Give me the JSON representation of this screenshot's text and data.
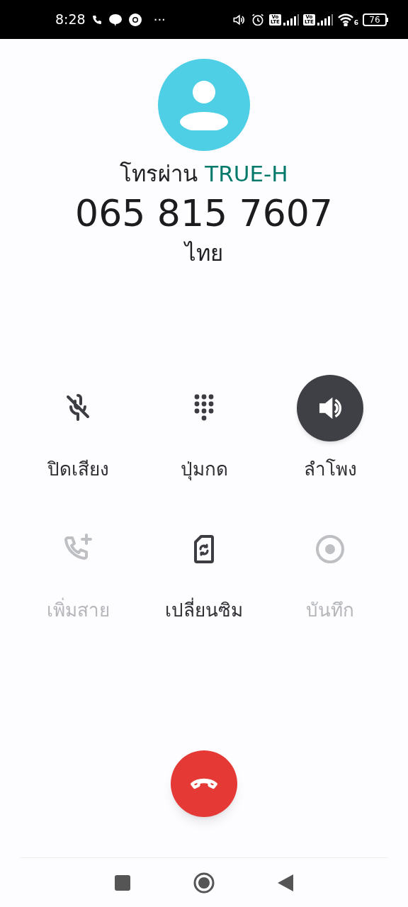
{
  "status_bar": {
    "time": "8:28",
    "more": "···",
    "sims": [
      {
        "top": "Vo",
        "bottom": "LTE"
      },
      {
        "top": "Vo",
        "bottom": "LTE"
      }
    ],
    "wifi_badge": "6",
    "battery": "76"
  },
  "call": {
    "via_prefix": "โทรผ่าน",
    "carrier": "TRUE-H",
    "number": "065 815 7607",
    "location": "ไทย"
  },
  "buttons": [
    {
      "kind": "mute",
      "label": "ปิดเสียง",
      "on": false,
      "disabled": false
    },
    {
      "kind": "keypad",
      "label": "ปุ่มกด",
      "on": false,
      "disabled": false
    },
    {
      "kind": "speaker",
      "label": "ลำโพง",
      "on": true,
      "disabled": false
    },
    {
      "kind": "add_call",
      "label": "เพิ่มสาย",
      "on": false,
      "disabled": true
    },
    {
      "kind": "switch_sim",
      "label": "เปลี่ยนซิม",
      "on": false,
      "disabled": false
    },
    {
      "kind": "record",
      "label": "บันทึก",
      "on": false,
      "disabled": true
    }
  ]
}
